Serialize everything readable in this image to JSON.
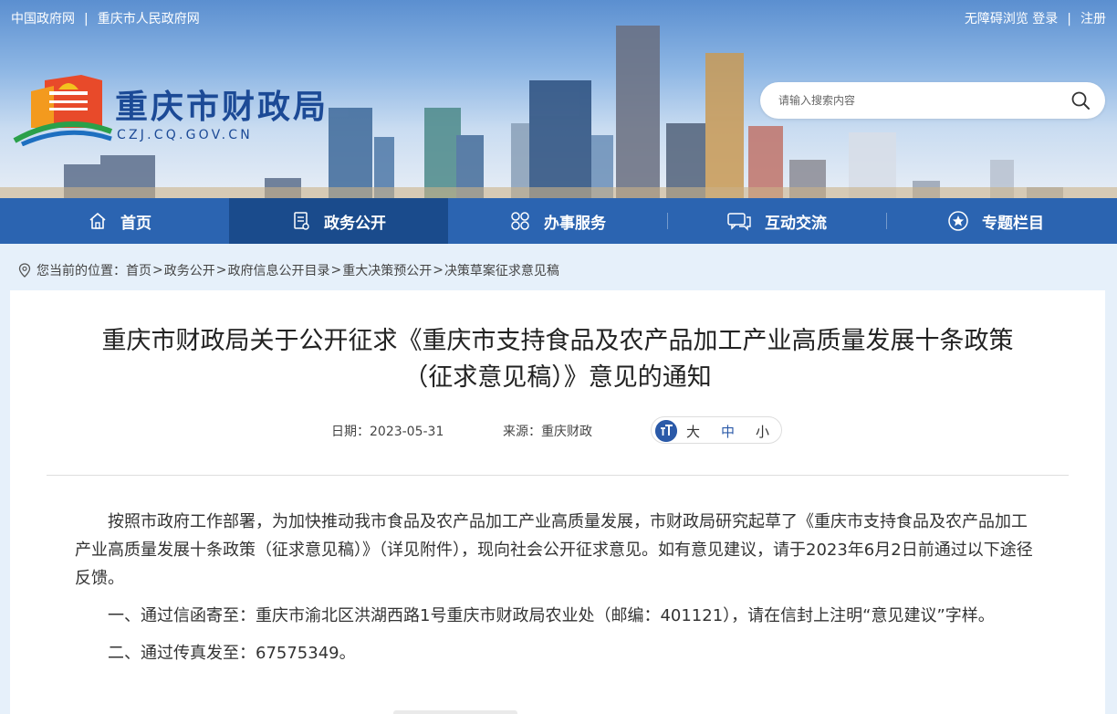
{
  "topbar": {
    "links_left": [
      "中国政府网",
      "重庆市人民政府网"
    ],
    "sep": "|",
    "links_right": [
      "无障碍浏览",
      "登录",
      "注册"
    ]
  },
  "site": {
    "name": "重庆市财政局",
    "url": "CZJ.CQ.GOV.CN"
  },
  "search": {
    "placeholder": "请输入搜索内容"
  },
  "nav": {
    "items": [
      {
        "label": "首页"
      },
      {
        "label": "政务公开"
      },
      {
        "label": "办事服务"
      },
      {
        "label": "互动交流"
      },
      {
        "label": "专题栏目"
      }
    ]
  },
  "breadcrumb": {
    "prefix": "您当前的位置：",
    "items": [
      "首页",
      "政务公开",
      "政府信息公开目录",
      "重大决策预公开",
      "决策草案征求意见稿"
    ],
    "sep": ">"
  },
  "article": {
    "title_line1": "重庆市财政局关于公开征求《重庆市支持食品及农产品加工产业高质量发展十条政策",
    "title_line2": "（征求意见稿）》意见的通知",
    "date": "日期：2023-05-31",
    "source": "来源：重庆财政",
    "font_size_options": [
      "大",
      "中",
      "小"
    ],
    "paragraphs": [
      "按照市政府工作部署，为加快推动我市食品及农产品加工产业高质量发展，市财政局研究起草了《重庆市支持食品及农产品加工产业高质量发展十条政策（征求意见稿）》（详见附件），现向社会公开征求意见。如有意见建议，请于2023年6月2日前通过以下途径反馈。",
      "一、通过信函寄至：重庆市渝北区洪湖西路1号重庆市财政局农业处（邮编：401121），请在信封上注明“意见建议”字样。",
      "二、通过传真发至：67575349。"
    ]
  },
  "colors": {
    "nav_bg": "#2b64b1",
    "nav_active": "#1a4b8c",
    "brand_text": "#1c4a96",
    "page_bg": "#e6f0fa"
  }
}
